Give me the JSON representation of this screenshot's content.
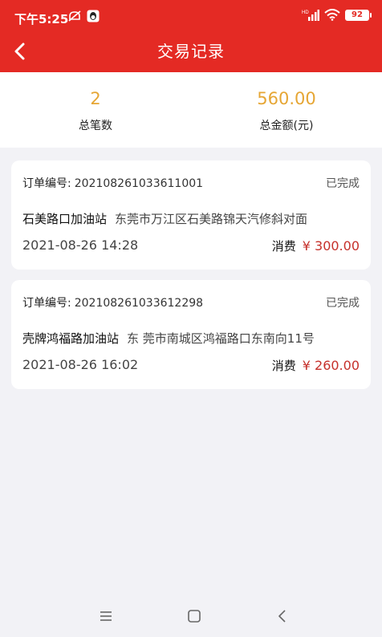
{
  "status_bar": {
    "time": "下午5:25",
    "battery": "92"
  },
  "nav": {
    "title": "交易记录"
  },
  "summary": {
    "count_value": "2",
    "count_label": "总笔数",
    "amount_value": "560.00",
    "amount_label": "总金额(元)"
  },
  "records": [
    {
      "order_label": "订单编号:",
      "order_no": "202108261033611001",
      "status": "已完成",
      "station": "石美路口加油站",
      "address": "东莞市万江区石美路锦天汽修斜对面",
      "time": "2021-08-26 14:28",
      "consume_label": "消费",
      "amount": "¥ 300.00"
    },
    {
      "order_label": "订单编号:",
      "order_no": "202108261033612298",
      "status": "已完成",
      "station": "壳牌鸿福路加油站",
      "address": "东 莞市南城区鸿福路口东南向11号",
      "time": "2021-08-26 16:02",
      "consume_label": "消费",
      "amount": "¥ 260.00"
    }
  ],
  "colors": {
    "header_red": "#e42a24",
    "summary_gold": "#e6a634",
    "amount_red": "#c6312b"
  },
  "icons": {
    "back": "chevron-left-icon",
    "system_menu": "menu-icon",
    "system_home": "square-icon",
    "system_back": "triangle-back-icon"
  }
}
